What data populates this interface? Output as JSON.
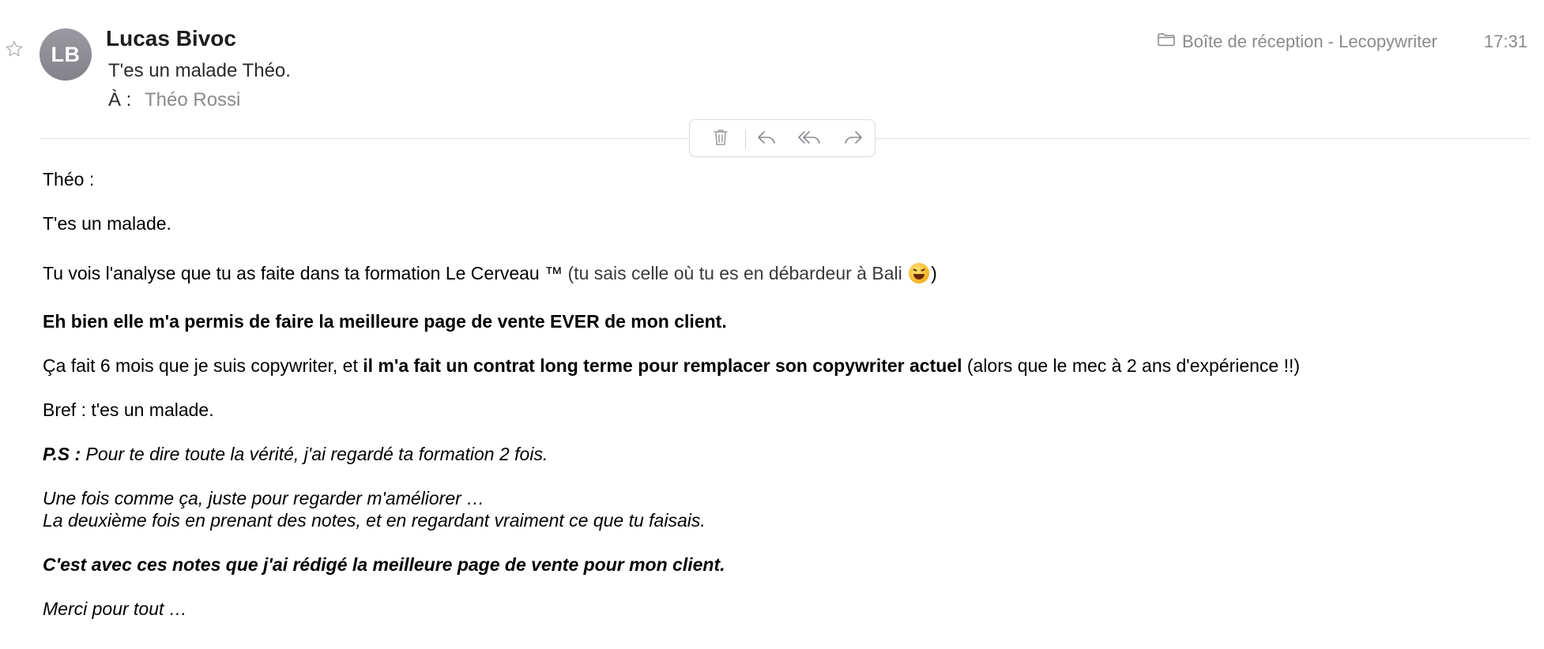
{
  "header": {
    "avatar_initials": "LB",
    "sender_name": "Lucas Bivoc",
    "subject": "T'es un malade Théo.",
    "to_label": "À :",
    "to_name": "Théo Rossi",
    "mailbox": "Boîte de réception - Lecopywriter",
    "time": "17:31",
    "icons": [
      "star-icon",
      "folder-icon"
    ]
  },
  "toolbar": {
    "buttons": [
      "trash-icon",
      "reply-icon",
      "reply-all-icon",
      "forward-icon"
    ]
  },
  "body": {
    "greeting": "Théo :",
    "line1": "T'es un malade.",
    "line2_main": "Tu vois l'analyse que tu as faite dans ta formation Le Cerveau ™ ",
    "line2_aside": "(tu sais celle où tu es en débardeur à Bali ",
    "line2_close": ")",
    "line3_bold": "Eh bien elle m'a permis de faire la meilleure page de vente EVER de mon client.",
    "line4_pre": "Ça fait 6 mois que je suis copywriter, et ",
    "line4_bold": "il m'a fait un contrat long terme pour remplacer son copywriter actuel",
    "line4_post": " (alors que le mec à 2 ans d'expérience !!)",
    "line5": "Bref : t'es un malade.",
    "ps_label": "P.S :",
    "ps_text": " Pour te dire toute la vérité, j'ai regardé ta formation 2 fois.",
    "line6": "Une fois comme ça, juste pour regarder m'améliorer …",
    "line7": "La deuxième fois en prenant des notes, et en regardant vraiment ce que tu faisais.",
    "line8_bold": "C'est avec ces notes que j'ai rédigé la meilleure page de vente pour mon client.",
    "line9": "Merci pour tout …"
  },
  "colors": {
    "avatar": "#8e8e93",
    "secondary_text": "#8a8a8e",
    "divider": "#e2e2e4"
  }
}
